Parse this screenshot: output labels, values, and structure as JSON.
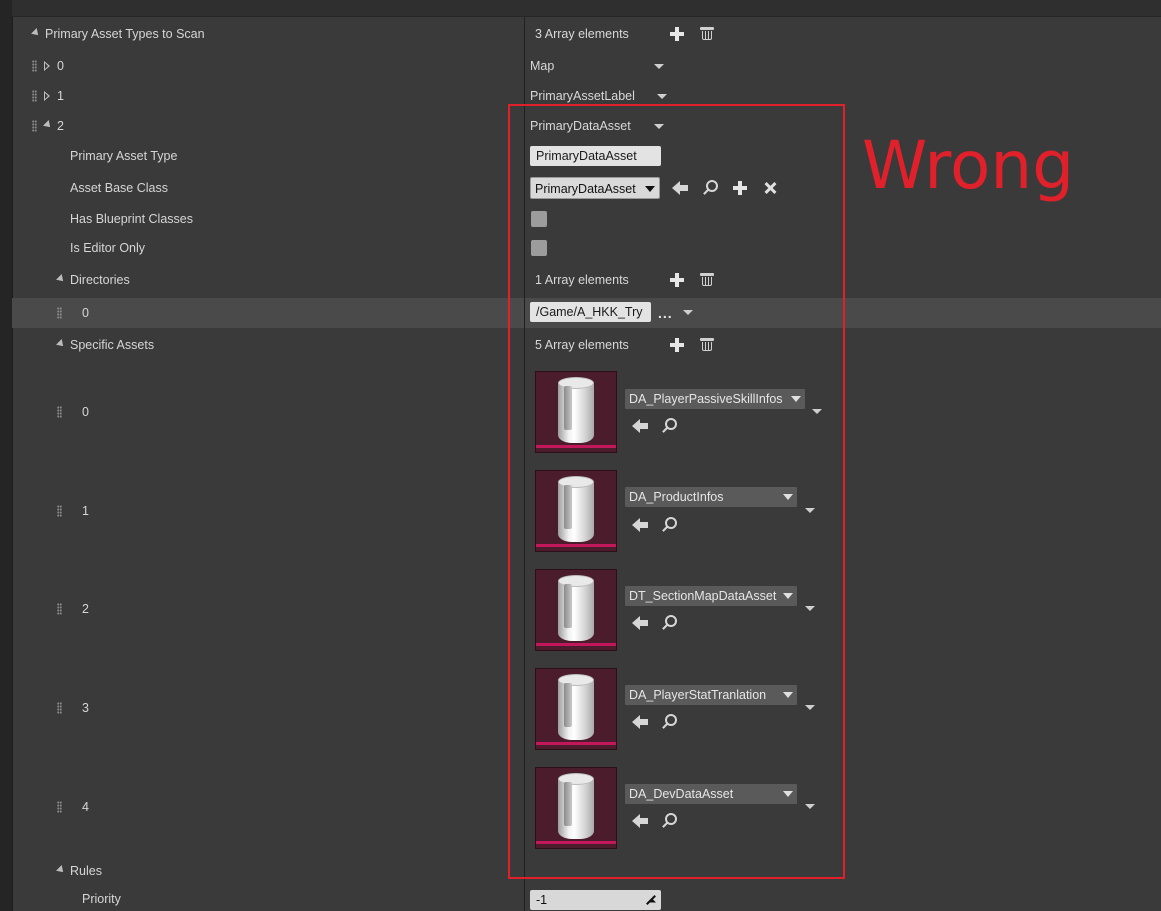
{
  "colors": {
    "panel_bg": "#3a3a3a",
    "highlight_border": "#e0202a",
    "thumbnail_bg": "#4a1c2c",
    "thumbnail_bar": "#c2185b"
  },
  "scan_section": {
    "label": "Primary Asset Types to Scan",
    "count_text": "3 Array elements"
  },
  "entries": [
    {
      "index": "0",
      "value": "Map"
    },
    {
      "index": "1",
      "value": "PrimaryAssetLabel"
    },
    {
      "index": "2",
      "value": "PrimaryDataAsset"
    }
  ],
  "entry2": {
    "primary_asset_type_label": "Primary Asset Type",
    "primary_asset_type_value": "PrimaryDataAsset",
    "asset_base_class_label": "Asset Base Class",
    "asset_base_class_value": "PrimaryDataAsset",
    "has_blueprint_classes_label": "Has Blueprint Classes",
    "has_blueprint_classes_checked": false,
    "is_editor_only_label": "Is Editor Only",
    "is_editor_only_checked": false
  },
  "directories": {
    "label": "Directories",
    "count_text": "1 Array elements",
    "items": [
      {
        "index": "0",
        "path": "/Game/A_HKK_Try",
        "more": "..."
      }
    ]
  },
  "specific_assets": {
    "label": "Specific Assets",
    "count_text": "5 Array elements",
    "items": [
      {
        "index": "0",
        "name": "DA_PlayerPassiveSkillInfos"
      },
      {
        "index": "1",
        "name": "DA_ProductInfos"
      },
      {
        "index": "2",
        "name": "DT_SectionMapDataAsset"
      },
      {
        "index": "3",
        "name": "DA_PlayerStatTranlation"
      },
      {
        "index": "4",
        "name": "DA_DevDataAsset"
      }
    ]
  },
  "rules": {
    "label": "Rules",
    "priority_label": "Priority",
    "priority_value": "-1"
  },
  "annotation": {
    "text": "Wrong"
  }
}
